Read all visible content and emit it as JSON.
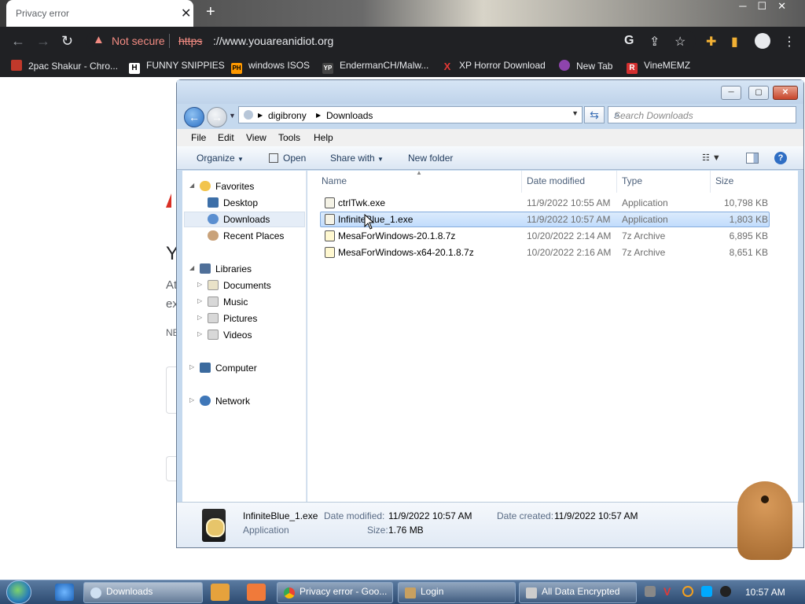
{
  "browser": {
    "tab_title": "Privacy error",
    "new_tab_symbol": "+",
    "security_label": "Not secure",
    "scheme": "https",
    "host": "://www.youareanidiot.org",
    "bookmarks": [
      {
        "label": "2pac Shakur - Chro...",
        "icon": "bookmark-icon",
        "color": "#c0392b"
      },
      {
        "label": "FUNNY SNIPPIES",
        "icon": "H",
        "color": "#ffffff"
      },
      {
        "label": "windows ISOS",
        "icon": "PH",
        "color": "#ff9900"
      },
      {
        "label": "EndermanCH/Malw...",
        "icon": "YP",
        "color": "#444444"
      },
      {
        "label": "XP Horror Download",
        "icon": "X",
        "color": "#e53935"
      },
      {
        "label": "New Tab",
        "icon": "globe-icon",
        "color": "#8e44ad"
      },
      {
        "label": "VineMEMZ",
        "icon": "R",
        "color": "#d32f2f"
      }
    ]
  },
  "background_page": {
    "fragments": [
      "Y",
      "At",
      "ex",
      "NE"
    ]
  },
  "explorer": {
    "breadcrumb": [
      "digibrony",
      "Downloads"
    ],
    "search_placeholder": "Search Downloads",
    "menu": [
      "File",
      "Edit",
      "View",
      "Tools",
      "Help"
    ],
    "commands": {
      "organize": "Organize",
      "open": "Open",
      "share_with": "Share with",
      "new_folder": "New folder"
    },
    "nav": {
      "favorites": "Favorites",
      "desktop": "Desktop",
      "downloads": "Downloads",
      "recent_places": "Recent Places",
      "libraries": "Libraries",
      "documents": "Documents",
      "music": "Music",
      "pictures": "Pictures",
      "videos": "Videos",
      "computer": "Computer",
      "network": "Network"
    },
    "columns": {
      "name": "Name",
      "date_modified": "Date modified",
      "type": "Type",
      "size": "Size"
    },
    "files": [
      {
        "name": "ctrlTwk.exe",
        "date": "11/9/2022 10:55 AM",
        "type": "Application",
        "size": "10,798 KB"
      },
      {
        "name": "InfiniteBlue_1.exe",
        "date": "11/9/2022 10:57 AM",
        "type": "Application",
        "size": "1,803 KB"
      },
      {
        "name": "MesaForWindows-20.1.8.7z",
        "date": "10/20/2022 2:14 AM",
        "type": "7z Archive",
        "size": "6,895 KB"
      },
      {
        "name": "MesaForWindows-x64-20.1.8.7z",
        "date": "10/20/2022 2:16 AM",
        "type": "7z Archive",
        "size": "8,651 KB"
      }
    ],
    "selected_index": 1,
    "details": {
      "filename": "InfiniteBlue_1.exe",
      "filetype": "Application",
      "modified_label": "Date modified:",
      "modified_value": "11/9/2022 10:57 AM",
      "created_label": "Date created:",
      "created_value": "11/9/2022 10:57 AM",
      "size_label": "Size:",
      "size_value": "1.76 MB"
    }
  },
  "taskbar": {
    "windows": [
      {
        "label": "Downloads",
        "active": true
      },
      {
        "label": "Privacy error - Goo...",
        "active": false
      },
      {
        "label": "Login",
        "active": false
      },
      {
        "label": "All Data Encrypted",
        "active": false
      }
    ],
    "clock": "10:57 AM"
  }
}
